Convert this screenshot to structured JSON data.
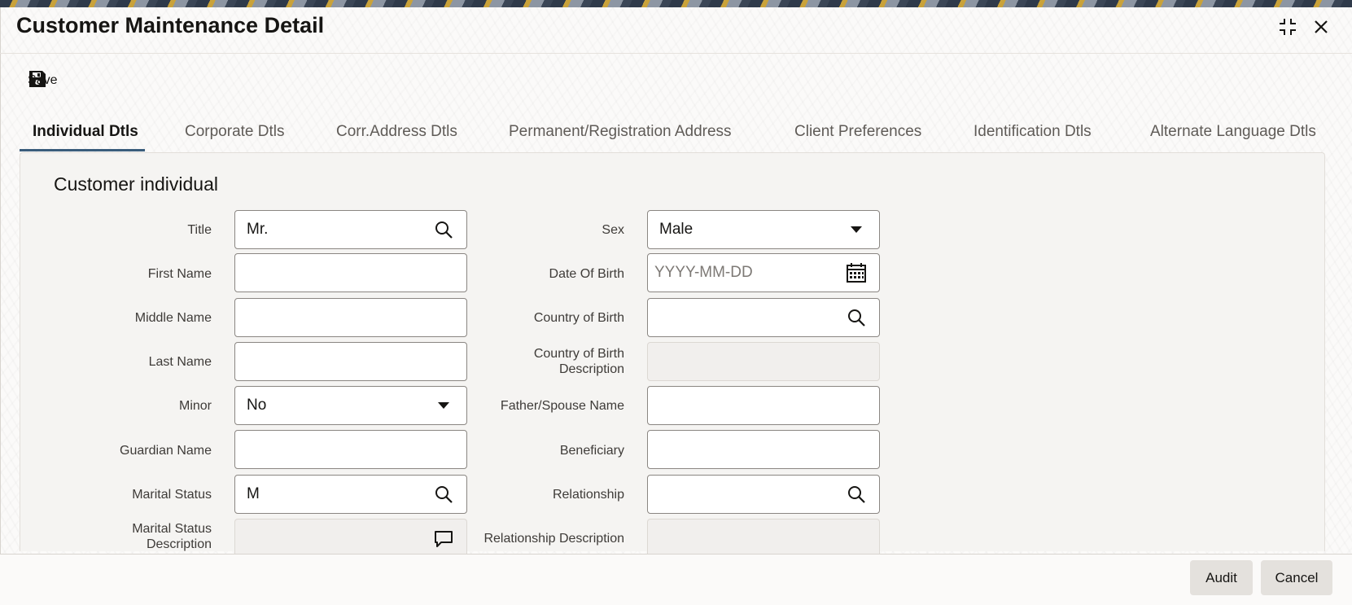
{
  "window": {
    "title": "Customer Maintenance Detail",
    "restore_icon": "restore-icon",
    "close_icon": "close-icon"
  },
  "toolbar": {
    "save_label": "Save",
    "save_icon": "floppy-disk-icon"
  },
  "tabs": [
    {
      "label": "Individual Dtls",
      "active": true
    },
    {
      "label": "Corporate Dtls",
      "active": false
    },
    {
      "label": "Corr.Address Dtls",
      "active": false
    },
    {
      "label": "Permanent/Registration Address",
      "active": false
    },
    {
      "label": "Client Preferences",
      "active": false
    },
    {
      "label": "Identification Dtls",
      "active": false
    },
    {
      "label": "Alternate Language Dtls",
      "active": false
    }
  ],
  "section": {
    "title": "Customer individual"
  },
  "left_fields": {
    "title": {
      "label": "Title",
      "value": "Mr.",
      "icon": "search-icon"
    },
    "first_name": {
      "label": "First Name",
      "value": ""
    },
    "middle_name": {
      "label": "Middle Name",
      "value": ""
    },
    "last_name": {
      "label": "Last Name",
      "value": ""
    },
    "minor": {
      "label": "Minor",
      "value": "No",
      "icon": "caret-down-icon"
    },
    "guardian_name": {
      "label": "Guardian Name",
      "value": ""
    },
    "marital_status": {
      "label": "Marital Status",
      "value": "M",
      "icon": "search-icon"
    },
    "marital_status_desc": {
      "label_line1": "Marital Status",
      "label_line2": "Description",
      "value": "",
      "icon": "comment-icon"
    }
  },
  "right_fields": {
    "sex": {
      "label": "Sex",
      "value": "Male",
      "icon": "caret-down-icon"
    },
    "dob": {
      "label": "Date Of Birth",
      "value": "",
      "placeholder": "YYYY-MM-DD",
      "icon": "calendar-icon"
    },
    "country_of_birth": {
      "label": "Country of Birth",
      "value": "",
      "icon": "search-icon"
    },
    "country_of_birth_desc": {
      "label_line1": "Country of Birth",
      "label_line2": "Description",
      "value": ""
    },
    "father_spouse_name": {
      "label": "Father/Spouse Name",
      "value": ""
    },
    "beneficiary": {
      "label": "Beneficiary",
      "value": ""
    },
    "relationship": {
      "label": "Relationship",
      "value": "",
      "icon": "search-icon"
    },
    "relationship_desc": {
      "label": "Relationship Description",
      "value": ""
    }
  },
  "footer": {
    "audit_label": "Audit",
    "cancel_label": "Cancel"
  }
}
